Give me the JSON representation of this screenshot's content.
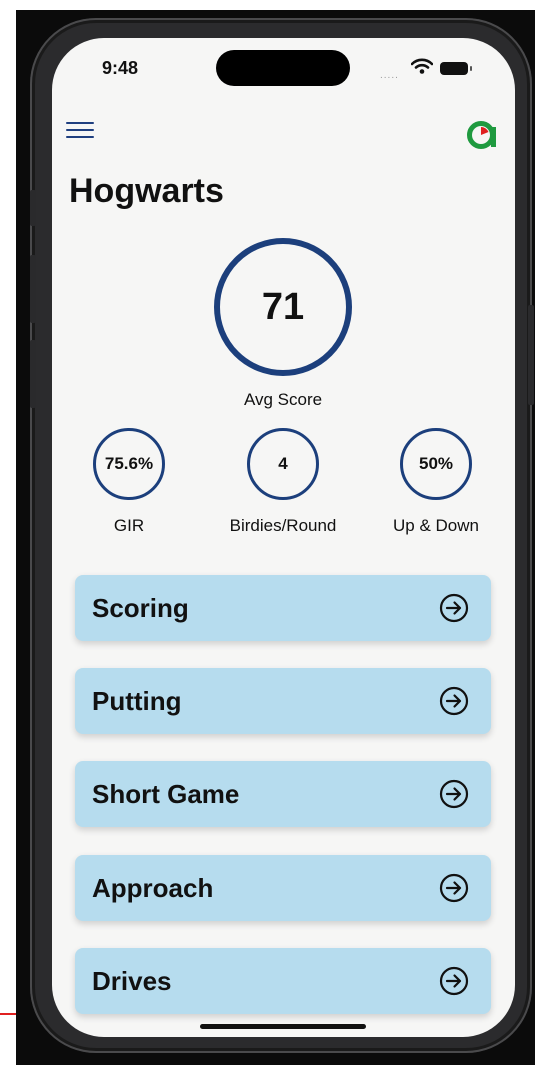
{
  "status_bar": {
    "time": "9:48",
    "signal": "....."
  },
  "header": {
    "menu_icon": "hamburger-menu-icon",
    "logo_icon": "app-logo-icon"
  },
  "page": {
    "title": "Hogwarts"
  },
  "primary_stat": {
    "value": "71",
    "label": "Avg Score"
  },
  "secondary_stats": [
    {
      "value": "75.6%",
      "label": "GIR"
    },
    {
      "value": "4",
      "label": "Birdies/Round"
    },
    {
      "value": "50%",
      "label": "Up & Down"
    }
  ],
  "categories": [
    {
      "label": "Scoring",
      "icon": "arrow-circle-right-icon"
    },
    {
      "label": "Putting",
      "icon": "arrow-circle-right-icon"
    },
    {
      "label": "Short Game",
      "icon": "arrow-circle-right-icon"
    },
    {
      "label": "Approach",
      "icon": "arrow-circle-right-icon"
    },
    {
      "label": "Drives",
      "icon": "arrow-circle-right-icon"
    }
  ],
  "colors": {
    "accent_navy": "#1c3f7c",
    "card_bg": "#b6dcee",
    "screen_bg": "#f6f6f5",
    "logo_green": "#1f9a3f",
    "logo_red": "#e02020"
  }
}
